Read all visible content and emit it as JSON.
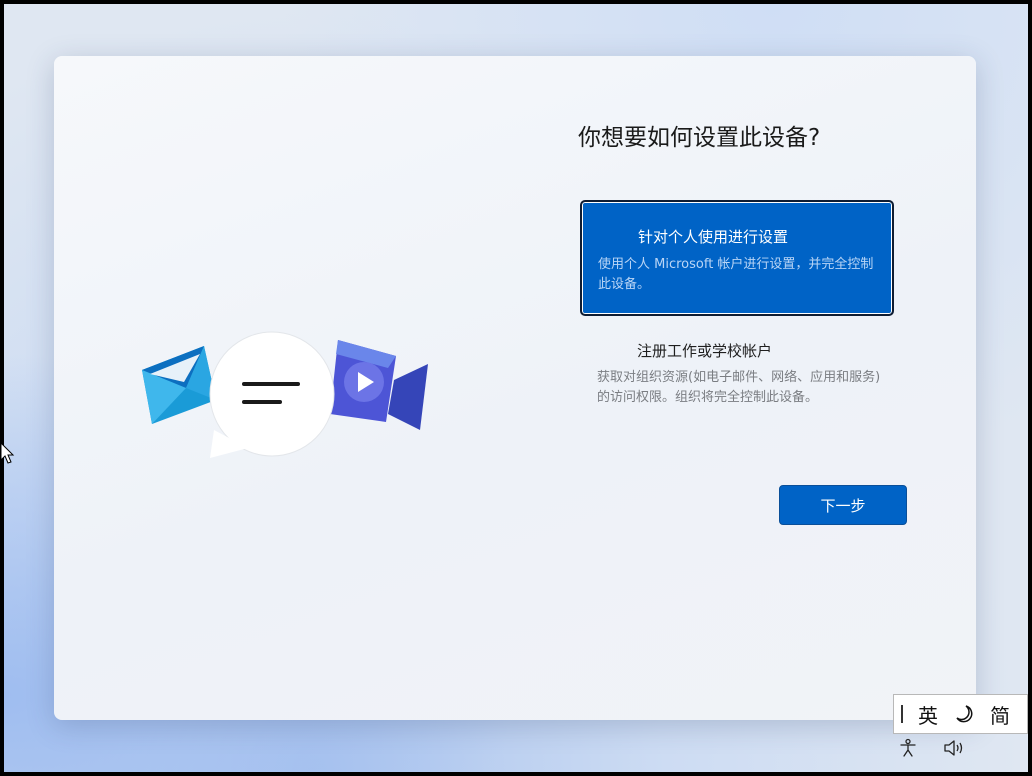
{
  "setup": {
    "title": "你想要如何设置此设备?",
    "options": [
      {
        "title": "针对个人使用进行设置",
        "description": "使用个人 Microsoft 帐户进行设置，并完全控制此设备。",
        "selected": true
      },
      {
        "title": "注册工作或学校帐户",
        "description": "获取对组织资源(如电子邮件、网络、应用和服务)的访问权限。组织将完全控制此设备。",
        "selected": false
      }
    ],
    "next_label": "下一步"
  },
  "ime": {
    "mode": "英",
    "moon_icon": "moon-icon",
    "script": "简"
  },
  "tray": {
    "accessibility_icon": "accessibility-icon",
    "volume_icon": "volume-icon"
  },
  "colors": {
    "accent": "#0063c6",
    "card_bg": "#f3f5f9",
    "desc_selected": "#b9d5f6"
  }
}
